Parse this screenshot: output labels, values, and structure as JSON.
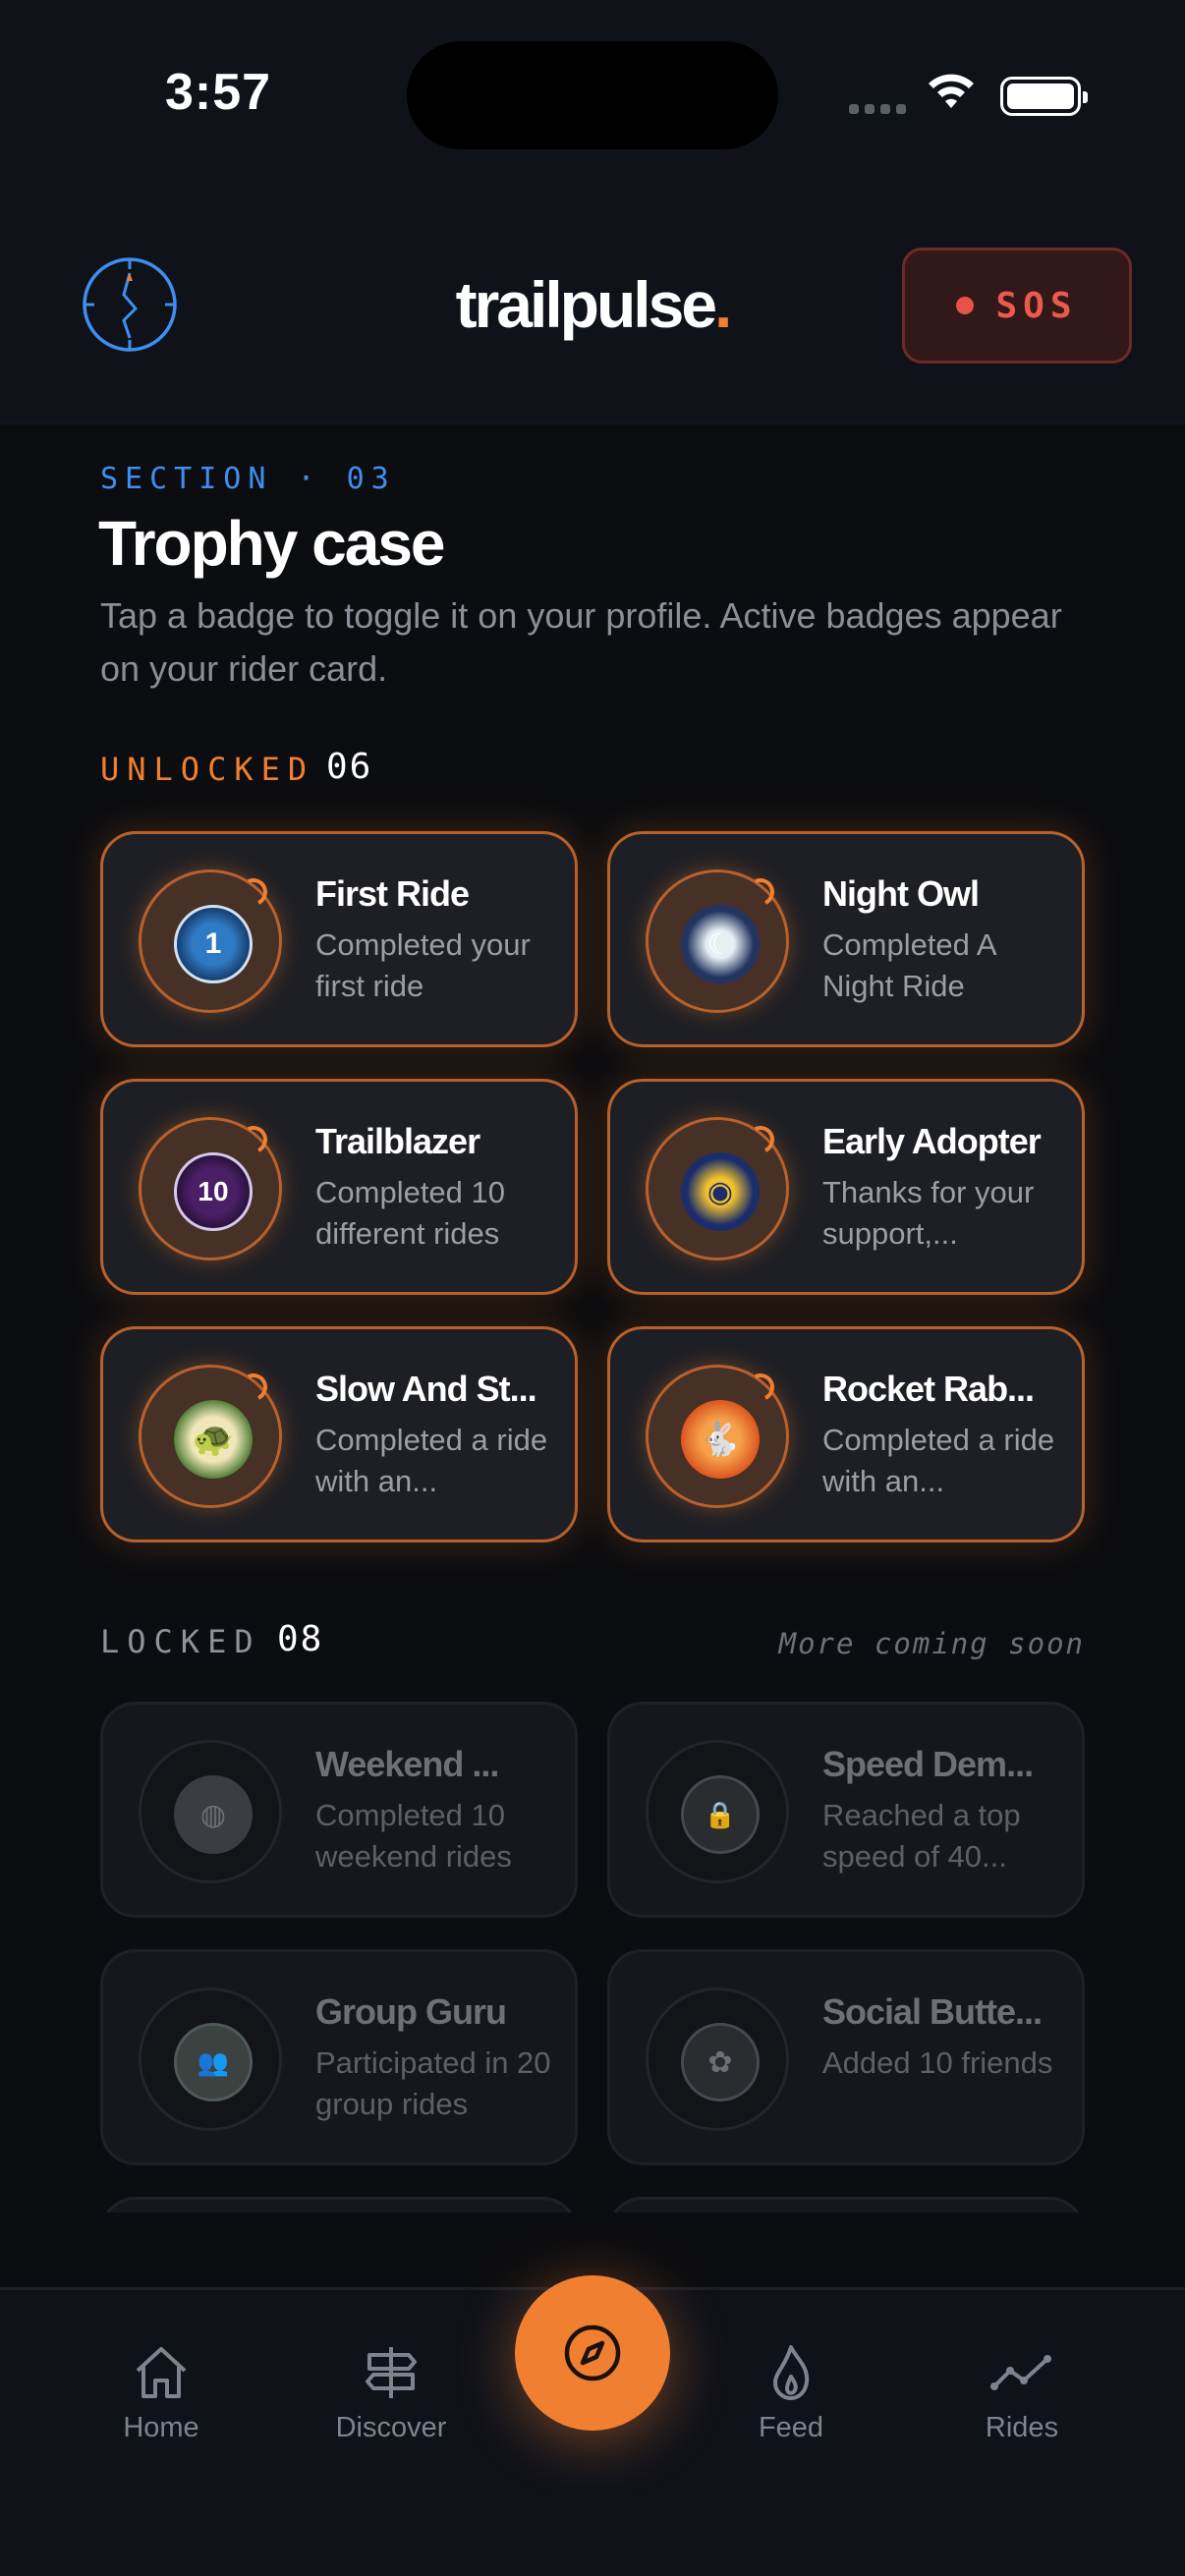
{
  "status_bar": {
    "time": "3:57"
  },
  "header": {
    "brand": "trailpulse",
    "brand_dot": ".",
    "sos_label": "SOS"
  },
  "section": {
    "eyebrow": "SECTION · 03",
    "title": "Trophy case",
    "subtitle": "Tap a badge to toggle it on your profile. Active badges appear on your rider card."
  },
  "unlocked": {
    "label": "UNLOCKED",
    "count": "06",
    "badges": [
      {
        "title": "First Ride",
        "desc": "Completed your first ride",
        "icon": "number-one-medal-icon",
        "glyph": "1"
      },
      {
        "title": "Night Owl",
        "desc": "Completed A Night Ride",
        "icon": "moon-rider-icon",
        "glyph": "☾"
      },
      {
        "title": "Trailblazer",
        "desc": "Completed 10 different rides",
        "icon": "number-ten-medal-icon",
        "glyph": "10"
      },
      {
        "title": "Early Adopter",
        "desc": "Thanks for your support,...",
        "icon": "helmet-icon",
        "glyph": "◉"
      },
      {
        "title": "Slow And St...",
        "desc": "Completed a ride with an...",
        "icon": "turtle-icon",
        "glyph": "🐢"
      },
      {
        "title": "Rocket Rab...",
        "desc": "Completed a ride with an...",
        "icon": "rocket-rabbit-icon",
        "glyph": "🐇"
      }
    ]
  },
  "locked": {
    "label": "LOCKED",
    "count": "08",
    "note": "More coming soon",
    "badges": [
      {
        "title": "Weekend ...",
        "desc": "Completed 10 weekend rides",
        "icon": "weekend-rider-icon",
        "glyph": "◍"
      },
      {
        "title": "Speed Dem...",
        "desc": "Reached a top speed of 40...",
        "icon": "locked-speed-icon",
        "glyph": "🔒"
      },
      {
        "title": "Group Guru",
        "desc": "Participated in 20 group rides",
        "icon": "group-icon",
        "glyph": "👥"
      },
      {
        "title": "Social Butte...",
        "desc": "Added 10 friends",
        "icon": "butterfly-icon",
        "glyph": "✿"
      }
    ]
  },
  "tabbar": {
    "tabs": [
      {
        "label": "Home",
        "icon": "home-icon"
      },
      {
        "label": "Discover",
        "icon": "signpost-icon"
      },
      {
        "label": "Feed",
        "icon": "flame-icon"
      },
      {
        "label": "Rides",
        "icon": "chart-line-icon"
      }
    ],
    "fab_icon": "compass-icon"
  },
  "colors": {
    "accent": "#f07f32",
    "blue": "#3f8ff0",
    "sos": "#ec5a4e",
    "bg": "#0c0d10"
  }
}
